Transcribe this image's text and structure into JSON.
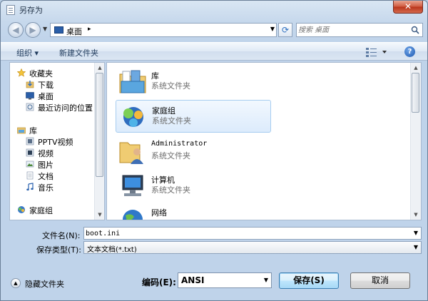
{
  "window": {
    "title": "另存为",
    "close_label": "✕"
  },
  "address": {
    "location": "桌面",
    "separator": "▸",
    "dropdown": "▼"
  },
  "search": {
    "placeholder": "搜索 桌面"
  },
  "toolbar": {
    "organize": "组织 ▾",
    "new_folder": "新建文件夹"
  },
  "nav": {
    "favorites": "收藏夹",
    "downloads": "下载",
    "desktop": "桌面",
    "recent": "最近访问的位置",
    "libraries": "库",
    "pptv": "PPTV视频",
    "videos": "视频",
    "pictures": "图片",
    "documents": "文档",
    "music": "音乐",
    "homegroup": "家庭组"
  },
  "files": [
    {
      "name": "库",
      "type": "系统文件夹"
    },
    {
      "name": "家庭组",
      "type": "系统文件夹"
    },
    {
      "name": "Administrator",
      "type": "系统文件夹"
    },
    {
      "name": "计算机",
      "type": "系统文件夹"
    },
    {
      "name": "网络",
      "type": ""
    }
  ],
  "form": {
    "filename_label": "文件名(N):",
    "filename_value": "boot.ini",
    "filetype_label": "保存类型(T):",
    "filetype_value": "文本文档(*.txt)",
    "hide_folders": "隐藏文件夹",
    "encoding_label": "编码(E):",
    "encoding_value": "ANSI",
    "save": "保存(S)",
    "cancel": "取消"
  },
  "colors": {
    "accent": "#2d6fc0",
    "selection": "#dcebfc"
  }
}
